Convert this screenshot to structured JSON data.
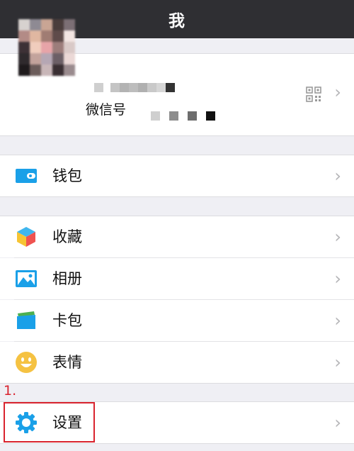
{
  "header": {
    "title": "我"
  },
  "profile": {
    "wechat_id_label": "微信号"
  },
  "menu": {
    "wallet": "钱包",
    "favorites": "收藏",
    "album": "相册",
    "cards": "卡包",
    "stickers": "表情",
    "settings": "设置"
  },
  "annotation": {
    "number": "1."
  },
  "colors": {
    "titlebar": "#2f2f33",
    "background": "#efeff4",
    "accent_blue": "#1aa0e8",
    "annotation_red": "#d9232e"
  },
  "icons": {
    "chevron": "›",
    "wallet": "wallet-icon",
    "favorites": "cube-icon",
    "album": "picture-icon",
    "cards": "card-icon",
    "stickers": "smiley-icon",
    "settings": "gear-icon",
    "qr": "qr-code-icon"
  }
}
